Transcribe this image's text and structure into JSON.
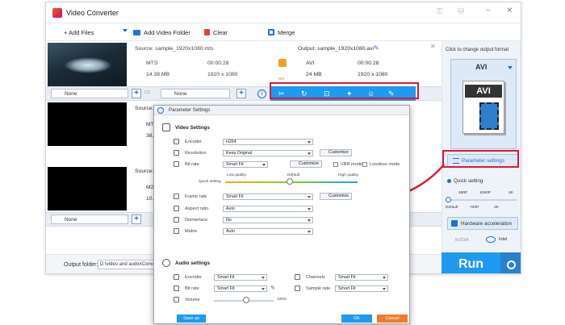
{
  "window": {
    "title": "Video Converter"
  },
  "toolbar": {
    "add_files": "+ Add Files",
    "add_folder": "Add Video Folder",
    "clear": "Clear",
    "merge": "Merge"
  },
  "file1": {
    "source": "Source: sample_1920x1080.mts",
    "fmt": "MTS",
    "dur": "00:00:28",
    "size": "14.38 MB",
    "res": "1920 x 1080",
    "output": "Output: sample_1920x1080.avi",
    "out_fmt": "AVI",
    "out_dur": "00:00:28",
    "out_size": "24 MB",
    "out_res": "1920 x 1080",
    "badge": "NVI"
  },
  "file2": {
    "source": "Source:",
    "fmt": "MT",
    "size": "38."
  },
  "file3": {
    "source": "Source:",
    "fmt": "M2",
    "size": "10."
  },
  "bar": {
    "subtitle": "None",
    "audio": "None",
    "cc": "CC"
  },
  "bottom": {
    "output_label": "Output folder:",
    "output_path": "D:\\video and audio\\Conver"
  },
  "right": {
    "hint": "Click to change output format",
    "format": "AVI",
    "param_btn": "Parameter settings",
    "quick": "Quick setting",
    "q_ticks_top": [
      "480P",
      "1080P",
      "4K"
    ],
    "q_ticks_bottom": [
      "Default",
      "720P",
      "2K"
    ],
    "hw": "Hardware acceleration",
    "nvidia": "NVIDIA",
    "intel": "Intel",
    "run": "Run"
  },
  "dialog": {
    "title": "Parameter Settings",
    "video_settings": "Video Settings",
    "encoder_label": "Encoder",
    "encoder_val": "H264",
    "resolution_label": "Resolution",
    "resolution_val": "Keep Original",
    "customize": "Customize",
    "bitrate_label": "Bit rate",
    "bitrate_val": "Smart Fit",
    "vbr": "VBR mode",
    "lossless": "Lossless mode",
    "q_low": "Low quality",
    "q_default": "Default",
    "q_high": "High quality",
    "quick_setting": "Quick setting",
    "framerate_label": "Frame rate",
    "framerate_val": "Smart Fit",
    "aspect_label": "Aspect ratio",
    "aspect_val": "Auto",
    "deinterlace_label": "Deinterlace",
    "deinterlace_val": "No",
    "matrix_label": "Matrix",
    "matrix_val": "Auto",
    "audio_settings": "Audio settings",
    "a_encoder_label": "Encoder",
    "a_encoder_val": "Smart Fit",
    "a_bitrate_label": "Bit rate",
    "a_bitrate_val": "Smart Fit",
    "channels_label": "Channels",
    "channels_val": "Smart Fit",
    "samplerate_label": "Sample rate",
    "samplerate_val": "Smart Fit",
    "volume_label": "Volume",
    "volume_val": "100%",
    "save_as": "Save as",
    "ok": "OK",
    "cancel": "Cancel"
  },
  "colors": {
    "accent": "#1e9af0",
    "highlight": "#e0182d",
    "cancel": "#f07a2a"
  }
}
